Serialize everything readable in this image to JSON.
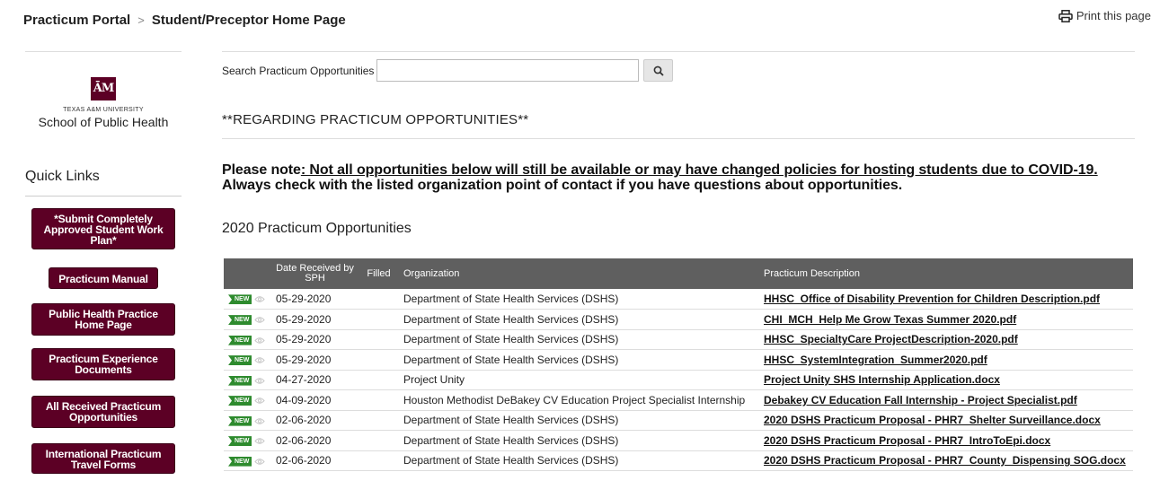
{
  "breadcrumb": {
    "root": "Practicum Portal",
    "separator": ">",
    "current": "Student/Preceptor Home Page"
  },
  "print_link": "Print this page",
  "logo": {
    "mark": "ĀM",
    "small": "TEXAS A&M UNIVERSITY",
    "big": "School of Public Health"
  },
  "quick_links": {
    "title": "Quick Links",
    "items": [
      {
        "label": "*Submit Completely Approved Student Work Plan*"
      },
      {
        "label": "Practicum Manual"
      },
      {
        "label": "Public Health Practice Home Page"
      },
      {
        "label": "Practicum Experience Documents"
      },
      {
        "label": "All Received Practicum Opportunities"
      },
      {
        "label": "International Practicum Travel Forms"
      }
    ]
  },
  "search": {
    "label": "Search Practicum Opportunities",
    "value": "",
    "placeholder": ""
  },
  "regarding": "**REGARDING PRACTICUM OPPORTUNITIES**",
  "note": {
    "prefix": "Please note",
    "underlined": ": Not all opportunities below will still be available or may have changed policies for hosting students due to COVID-19.",
    "second": "Always check with the listed organization point of contact if you have questions about opportunities."
  },
  "section_title": "2020 Practicum Opportunities",
  "table": {
    "headers": {
      "date": "Date Received by SPH",
      "filled": "Filled",
      "organization": "Organization",
      "description": "Practicum Description"
    },
    "badge": "NEW",
    "rows": [
      {
        "date": "05-29-2020",
        "filled": "",
        "org": "Department of State Health Services (DSHS)",
        "desc": "HHSC_Office of Disability Prevention for Children Description.pdf"
      },
      {
        "date": "05-29-2020",
        "filled": "",
        "org": "Department of State Health Services (DSHS)",
        "desc": "CHI_MCH_Help Me Grow Texas Summer 2020.pdf"
      },
      {
        "date": "05-29-2020",
        "filled": "",
        "org": "Department of State Health Services (DSHS)",
        "desc": "HHSC_SpecialtyCare ProjectDescription-2020.pdf"
      },
      {
        "date": "05-29-2020",
        "filled": "",
        "org": "Department of State Health Services (DSHS)",
        "desc": "HHSC_SystemIntegration_Summer2020.pdf"
      },
      {
        "date": "04-27-2020",
        "filled": "",
        "org": "Project Unity",
        "desc": "Project Unity SHS Internship Application.docx"
      },
      {
        "date": "04-09-2020",
        "filled": "",
        "org": "Houston Methodist DeBakey CV Education Project Specialist Internship",
        "desc": "Debakey CV Education Fall Internship - Project Specialist.pdf"
      },
      {
        "date": "02-06-2020",
        "filled": "",
        "org": "Department of State Health Services (DSHS)",
        "desc": "2020 DSHS Practicum Proposal - PHR7_Shelter Surveillance.docx"
      },
      {
        "date": "02-06-2020",
        "filled": "",
        "org": "Department of State Health Services (DSHS)",
        "desc": "2020 DSHS Practicum Proposal - PHR7_IntroToEpi.docx"
      },
      {
        "date": "02-06-2020",
        "filled": "",
        "org": "Department of State Health Services (DSHS)",
        "desc": "2020 DSHS Practicum Proposal - PHR7_County_Dispensing SOG.docx"
      }
    ]
  },
  "colors": {
    "maroon": "#5c0025",
    "header_gray": "#5f5f5f",
    "new_green": "#2e8b2e"
  }
}
